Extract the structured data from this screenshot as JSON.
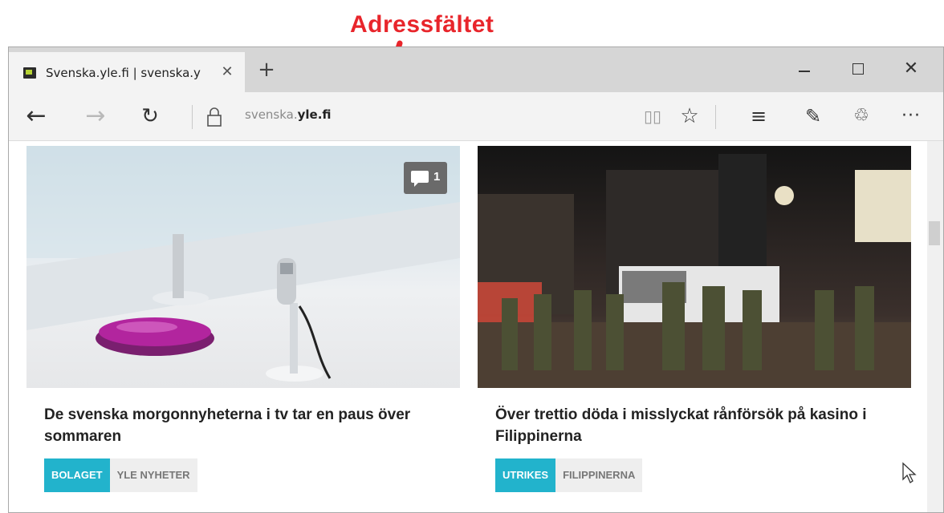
{
  "annotation": {
    "label": "Adressfältet",
    "color": "#e8252b"
  },
  "tab": {
    "title": "Svenska.yle.fi | svenska.y",
    "close_glyph": "✕",
    "new_tab_glyph": "+"
  },
  "window_controls": {
    "close_glyph": "✕"
  },
  "navigation": {
    "back_glyph": "←",
    "forward_glyph": "→",
    "refresh_glyph": "↻",
    "url_prefix": "svenska.",
    "url_domain": "yle.fi",
    "reading_glyph": "▯▯",
    "star_glyph": "☆",
    "hub_glyph": "≡",
    "note_glyph": "✎",
    "share_glyph": "♲",
    "more_glyph": "···"
  },
  "articles": [
    {
      "title": "De svenska morgonnyheterna i tv tar en paus över sommaren",
      "comment_count": "1",
      "tags": [
        "BOLAGET",
        "YLE NYHETER"
      ]
    },
    {
      "title": "Över trettio döda i misslyckat rånförsök på kasino i Filippinerna",
      "tags": [
        "UTRIKES",
        "FILIPPINERNA"
      ]
    }
  ],
  "colors": {
    "tag_primary": "#22b3cc",
    "tag_secondary": "#eeeeee",
    "annotation": "#e8252b"
  }
}
